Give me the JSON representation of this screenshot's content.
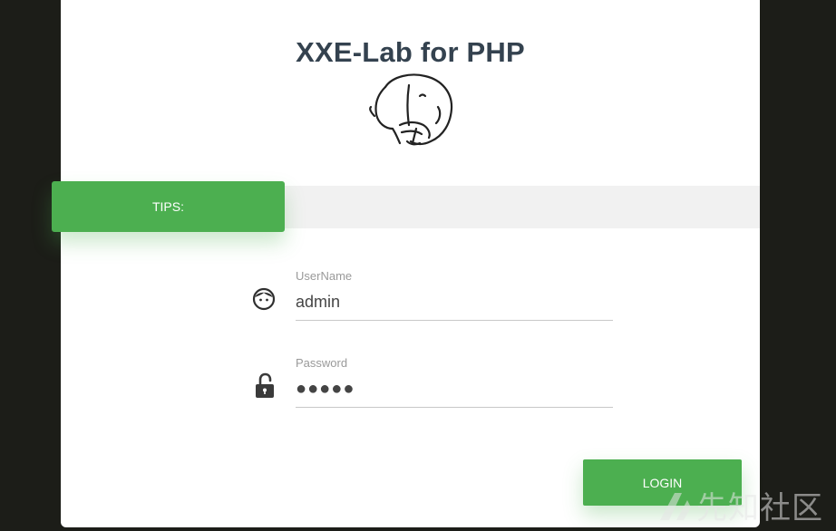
{
  "header": {
    "title": "XXE-Lab for PHP",
    "logo_icon": "php-elephant-icon"
  },
  "tips": {
    "label": "TIPS:"
  },
  "form": {
    "username": {
      "label": "UserName",
      "value": "admin",
      "icon": "user-face-icon"
    },
    "password": {
      "label": "Password",
      "value": "●●●●●",
      "icon": "unlocked-padlock-icon"
    },
    "login_label": "LOGIN"
  },
  "watermark": {
    "text": "先知社区"
  },
  "colors": {
    "accent": "#4caf50",
    "title": "#34424f",
    "background": "#1c1d18",
    "card": "#ffffff",
    "band": "#f1f1f1"
  }
}
